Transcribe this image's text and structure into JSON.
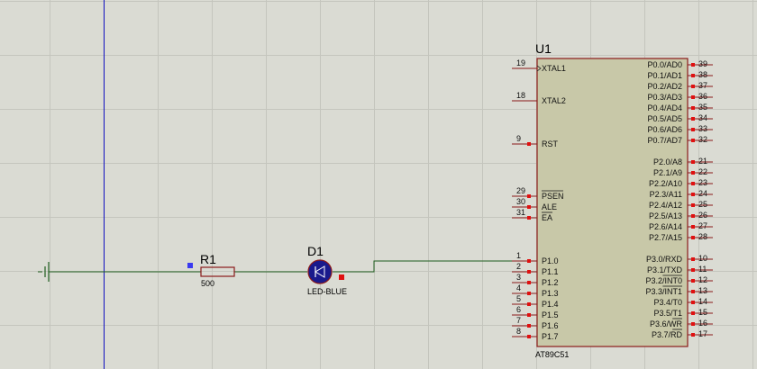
{
  "colors": {
    "background": "#dadbd3",
    "grid": "#c4c5bd",
    "wire": "#1f5e1f",
    "component_outline": "#8b1a1a",
    "chip_fill": "#c8c8a8",
    "pin_marker": "#e01010",
    "cursor_line": "#1010c0",
    "led_fill": "#1a1a8c"
  },
  "resistor": {
    "ref": "R1",
    "value": "500"
  },
  "led": {
    "ref": "D1",
    "value": "LED-BLUE"
  },
  "chip": {
    "ref": "U1",
    "part": "AT89C51",
    "left_pins": [
      {
        "num": "19",
        "name": "XTAL1"
      },
      {
        "num": "18",
        "name": "XTAL2"
      },
      {
        "num": "9",
        "name": "RST"
      },
      {
        "num": "29",
        "name": "PSEN"
      },
      {
        "num": "30",
        "name": "ALE"
      },
      {
        "num": "31",
        "name": "EA"
      },
      {
        "num": "1",
        "name": "P1.0"
      },
      {
        "num": "2",
        "name": "P1.1"
      },
      {
        "num": "3",
        "name": "P1.2"
      },
      {
        "num": "4",
        "name": "P1.3"
      },
      {
        "num": "5",
        "name": "P1.4"
      },
      {
        "num": "6",
        "name": "P1.5"
      },
      {
        "num": "7",
        "name": "P1.6"
      },
      {
        "num": "8",
        "name": "P1.7"
      }
    ],
    "right_pins": [
      {
        "num": "39",
        "name": "P0.0/AD0"
      },
      {
        "num": "38",
        "name": "P0.1/AD1"
      },
      {
        "num": "37",
        "name": "P0.2/AD2"
      },
      {
        "num": "36",
        "name": "P0.3/AD3"
      },
      {
        "num": "35",
        "name": "P0.4/AD4"
      },
      {
        "num": "34",
        "name": "P0.5/AD5"
      },
      {
        "num": "33",
        "name": "P0.6/AD6"
      },
      {
        "num": "32",
        "name": "P0.7/AD7"
      },
      {
        "num": "21",
        "name": "P2.0/A8"
      },
      {
        "num": "22",
        "name": "P2.1/A9"
      },
      {
        "num": "23",
        "name": "P2.2/A10"
      },
      {
        "num": "24",
        "name": "P2.3/A11"
      },
      {
        "num": "25",
        "name": "P2.4/A12"
      },
      {
        "num": "26",
        "name": "P2.5/A13"
      },
      {
        "num": "27",
        "name": "P2.6/A14"
      },
      {
        "num": "28",
        "name": "P2.7/A15"
      },
      {
        "num": "10",
        "name": "P3.0/RXD"
      },
      {
        "num": "11",
        "name": "P3.1/TXD"
      },
      {
        "num": "12",
        "name": "P3.2/INT0"
      },
      {
        "num": "13",
        "name": "P3.3/INT1"
      },
      {
        "num": "14",
        "name": "P3.4/T0"
      },
      {
        "num": "15",
        "name": "P3.5/T1"
      },
      {
        "num": "16",
        "name": "P3.6/WR"
      },
      {
        "num": "17",
        "name": "P3.7/RD"
      }
    ]
  }
}
